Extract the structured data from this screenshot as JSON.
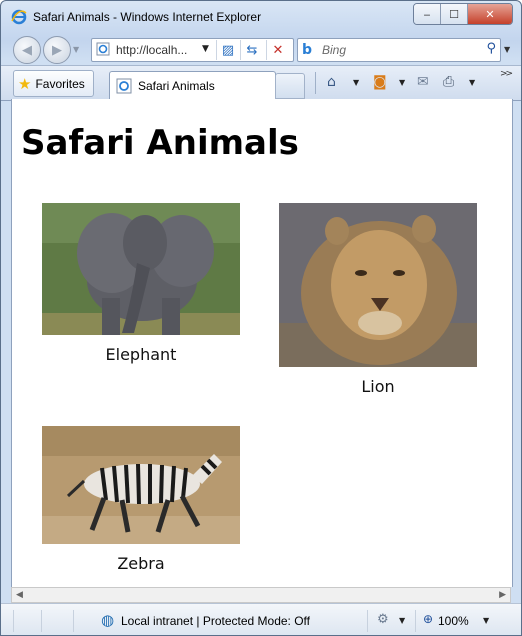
{
  "window": {
    "title": "Safari Animals - Windows Internet Explorer",
    "controls": {
      "minimize": "‒",
      "maximize": "☐",
      "close": "✕"
    }
  },
  "navigation": {
    "back_icon": "back-arrow-icon",
    "forward_icon": "forward-arrow-icon",
    "address": "http://localh...",
    "search_placeholder": "Bing",
    "search_provider": "bing-logo-icon"
  },
  "tabs": {
    "favorites_label": "Favorites",
    "active_tab_label": "Safari Animals"
  },
  "page": {
    "heading": "Safari Animals",
    "animals": [
      {
        "caption": "Elephant",
        "image": "elephant-photo"
      },
      {
        "caption": "Lion",
        "image": "lion-photo"
      },
      {
        "caption": "Zebra",
        "image": "zebra-photo"
      }
    ]
  },
  "status": {
    "zone_text": "Local intranet | Protected Mode: Off",
    "zoom_text": "100%"
  },
  "colors": {
    "close_button": "#c5412b",
    "frame": "#c3d5ee",
    "favorites_star": "#f2b90f"
  }
}
